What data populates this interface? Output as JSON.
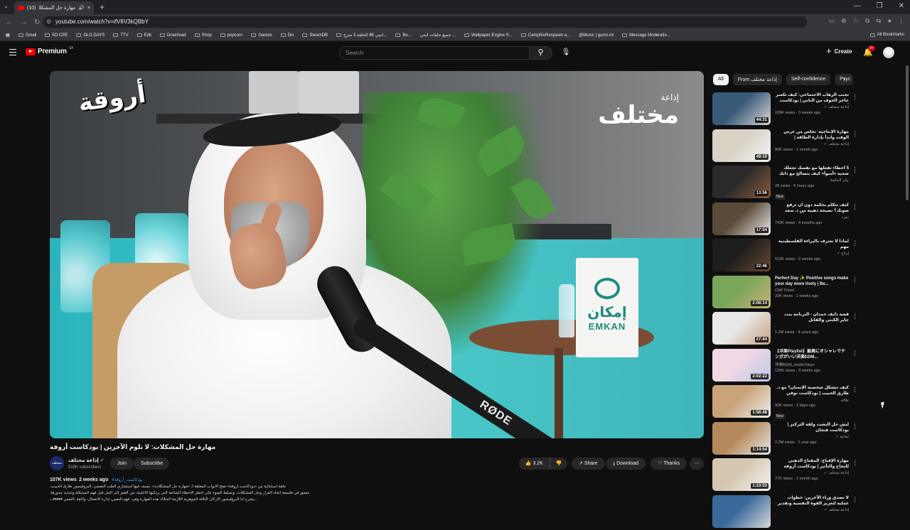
{
  "browser": {
    "tab_title": "مهارة حل المشكلات: لا ت",
    "tab_counter": "(10)",
    "url": "youtube.com/watch?v=ifV8V3kQBbY",
    "bookmarks": [
      "Gmail",
      "5G CPE",
      "OLD DAYS",
      "TTV",
      "Edit",
      "Download",
      "Shop",
      "popcorn",
      "Games",
      "Dis",
      "SteamDB",
      "انمي 86 الحلقة 3 مترج...",
      "Bo...",
      "جميع حلقات انمي ...",
      "Wallpaper Engine S...",
      "CampfireRespawn a...",
      "@Music | gums.lol",
      "Message Moderatio..."
    ],
    "all_bookmarks": "All Bookmarks"
  },
  "header": {
    "logo_text": "Premium",
    "logo_sup": "SA",
    "search_placeholder": "Search",
    "create_label": "Create",
    "notif_badge": "9+"
  },
  "player": {
    "overlay_left": "أروقة",
    "overlay_right_small": "إذاعة",
    "overlay_right_big": "مختلف",
    "sign_ar": "إمكان",
    "sign_en": "EMKAN",
    "mic_brand": "RØDE"
  },
  "video": {
    "title": "مهارة حل المشكلات: لا تلوم الآخرين | بودكاست أروقة",
    "channel_avatar_text": "مختلف",
    "channel_name": "إذاعة مختلف ✓",
    "subscribers": "528K subscribers",
    "join_label": "Join",
    "subscribe_label": "Subscribe",
    "likes": "3.2K",
    "share_label": "Share",
    "download_label": "Download",
    "thanks_label": "Thanks",
    "views": "107K views",
    "age": "2 weeks ago",
    "tag": "#بودكاست_أروقة",
    "desc_line1": "حلقة استثنائية من «بودكاست أروقة» تفتح الأبواب المغلقة لـ «مهارة حل المشكلات»، بضيف فيها استشاري الطب النفسي، البروفيسور طارق الحبيب.",
    "desc_line2": "نتعمق في فلسفة اتخاذ القرار وحل المشكلات، ونسلط الضوء على أخطر الأخطاء الشائعة التي يرتكبها الأغلبية، من القفز إلى الحل قبل فهم المشكلة وتحديد جذورها،",
    "desc_line3": "يشرح لنا البروفيسور الأركان الثلاثة الجوهرية اللازمة لامتلاك هذه المهارة وهي: فهم النفس، إدارة الانفعال، والثقة بالنفس...",
    "more_label": "...more"
  },
  "chips": [
    "All",
    "From إذاعة مختلف",
    "Self-confidence",
    "Psyc"
  ],
  "recommendations": [
    {
      "title": "تجنب الرهاب الاجتماعي: كيف تكسر حاجز الخوف من الناس | بودكاست أروقة",
      "channel": "إذاعة مختلف ✓",
      "views": "109K views",
      "age": "3 weeks ago",
      "duration": "44:31",
      "new": "",
      "c1": "#3a5a7a",
      "c2": "#d8d8d8"
    },
    {
      "title": "مهارة الإنتاجية: تخلّص من عرس الوقت وابدأ بإدارة الطاقة | بودكاست أروقة",
      "channel": "إذاعة مختلف ✓",
      "views": "89K views",
      "age": "1 month ago",
      "duration": "49:10",
      "new": "",
      "c1": "#d9d2c5",
      "c2": "#f4f4f4"
    },
    {
      "title": "5 أخطاء تفعلها مع نفسك تجعلك ضحية «أسوأ» كيف تتصالح مع ذاتك ... كريم ...",
      "channel": "بيان الحكمة",
      "views": "28 views",
      "age": "6 hours ago",
      "duration": "13:56",
      "new": "New",
      "c1": "#2a2a2a",
      "c2": "#8a5a3a"
    },
    {
      "title": "كيف تتكلم بحكمة دون أن ترفع صوتك؟ نصيحة ذهبية من د. سعد العريفي",
      "channel": "سرد",
      "views": "742K views",
      "age": "4 months ago",
      "duration": "17:54",
      "new": "",
      "c1": "#5a4a38",
      "c2": "#eaeaea"
    },
    {
      "title": "لماذا لا نعترف بالبراءة الفلسطينية مهم",
      "channel": "إبداع ✓",
      "views": "515K views",
      "age": "2 weeks ago",
      "duration": "22:46",
      "new": "",
      "c1": "#1e1e1e",
      "c2": "#6a4a30"
    },
    {
      "title": "Perfect Day ✨ Positive songs make your day more lively | Be...",
      "channel": "Chill Travel",
      "views": "22K views",
      "age": "2 weeks ago",
      "duration": "2:08:14",
      "new": "",
      "c1": "#7aa65a",
      "c2": "#c9b37a"
    },
    {
      "title": "قصة ذايف حمدان - البرنامه بنت جاير الكنتي والقاتل",
      "channel": "-",
      "views": "1.2M views",
      "age": "4 years ago",
      "duration": "27:44",
      "new": "",
      "c1": "#e8e8e8",
      "c2": "#c9a080"
    },
    {
      "title": "【洋楽Playlist】最高にオシャレでテンポがいい洋楽EDM...",
      "channel": "洋楽BGM_studioTokyo",
      "views": "125K views",
      "age": "3 weeks ago",
      "duration": "2:02:22",
      "new": "",
      "c1": "#f2d8e4",
      "c2": "#b8c8e8"
    },
    {
      "title": "كيف تتشكل شخصية الإنسان؟ مع د. طارق الحبيب | بودكاست نوفي",
      "channel": "نوفي",
      "views": "92K views",
      "age": "3 days ago",
      "duration": "1:58:48",
      "new": "New",
      "c1": "#c9a37a",
      "c2": "#f0f0f0"
    },
    {
      "title": "ليش حل النشت ولقة التركيز | بودكاست فنجان",
      "channel": "ثمانية ✓",
      "views": "2.2M views",
      "age": "1 year ago",
      "duration": "1:14:54",
      "new": "",
      "c1": "#b58a5a",
      "c2": "#e8e8e8"
    },
    {
      "title": "مهارة الإقناع: المفتاح الذهبي للنجاح والتأثير | بودكاست أروقة",
      "channel": "إذاعة مختلف ✓",
      "views": "77K views",
      "age": "1 month ago",
      "duration": "1:23:53",
      "new": "",
      "c1": "#d6c8b0",
      "c2": "#f4f4f4"
    },
    {
      "title": "لا تصدق وراء الآخرين: خطوات عملية لتعزيز القوة النفسية وتقدير الذات | بودكاست",
      "channel": "إذاعة مختلف ✓",
      "views": "",
      "age": "",
      "duration": "",
      "new": "",
      "c1": "#3a6a9a",
      "c2": "#d8d8d8"
    }
  ]
}
